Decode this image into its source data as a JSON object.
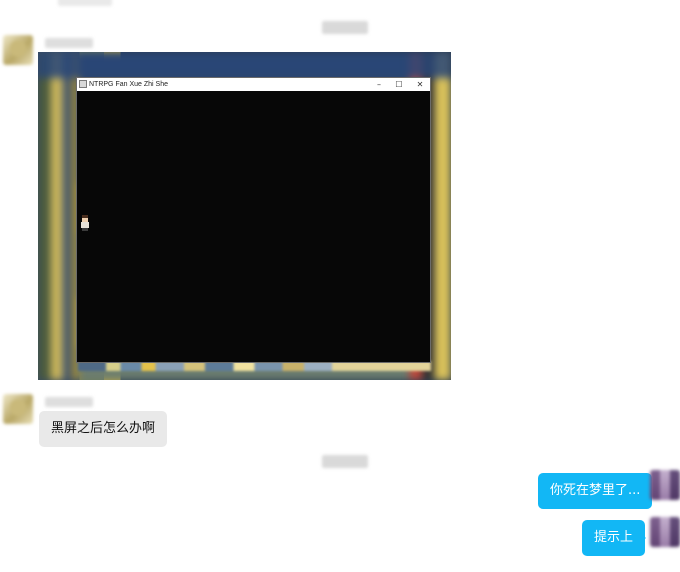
{
  "game_window": {
    "title": "NTRPG Fan Xue Zhi She",
    "minimize_glyph": "–",
    "maximize_glyph": "☐",
    "close_glyph": "✕"
  },
  "messages": [
    {
      "direction": "incoming",
      "kind": "image",
      "content": "screenshot of black game window"
    },
    {
      "direction": "incoming",
      "kind": "text",
      "text": "黑屏之后怎么办啊"
    },
    {
      "direction": "outgoing",
      "kind": "text",
      "text": "你死在梦里了..."
    },
    {
      "direction": "outgoing",
      "kind": "text",
      "text": "提示上"
    }
  ],
  "colors": {
    "outgoing_bubble": "#12b7f5",
    "incoming_bubble": "#e9e9e9",
    "game_canvas": "#070707"
  },
  "icons": [
    "app-icon",
    "minimize-icon",
    "maximize-icon",
    "close-icon"
  ]
}
